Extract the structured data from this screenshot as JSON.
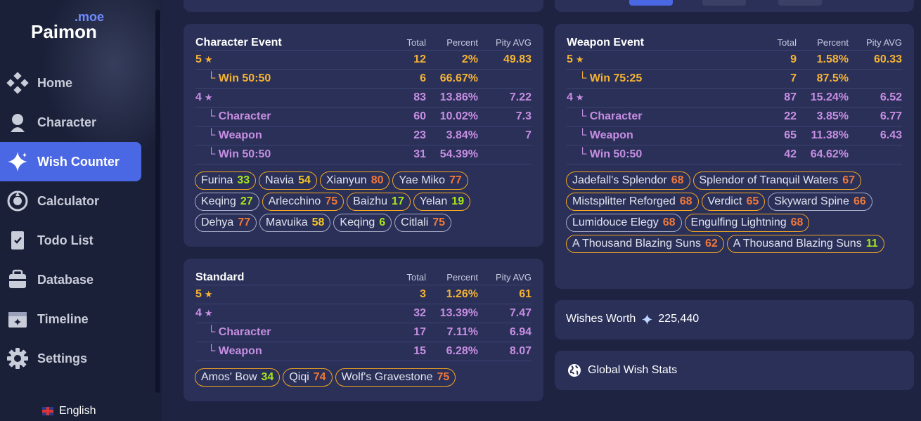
{
  "brand": {
    "moe": ".moe",
    "name": "Paimon"
  },
  "nav": [
    {
      "label": "Home",
      "icon": "home-icon",
      "active": false
    },
    {
      "label": "Character",
      "icon": "character-icon",
      "active": false
    },
    {
      "label": "Wish Counter",
      "icon": "sparkle-icon",
      "active": true
    },
    {
      "label": "Calculator",
      "icon": "calculator-icon",
      "active": false
    },
    {
      "label": "Todo List",
      "icon": "todo-icon",
      "active": false
    },
    {
      "label": "Database",
      "icon": "database-icon",
      "active": false
    },
    {
      "label": "Timeline",
      "icon": "timeline-icon",
      "active": false
    },
    {
      "label": "Settings",
      "icon": "gear-icon",
      "active": false
    }
  ],
  "language": "English",
  "headers": {
    "total": "Total",
    "percent": "Percent",
    "pity": "Pity AVG"
  },
  "character_event": {
    "title": "Character Event",
    "rows": [
      {
        "label": "5",
        "star": true,
        "color": "gold",
        "total": "12",
        "percent": "2%",
        "pity": "49.83"
      },
      {
        "label": "└ Win 50:50",
        "color": "gold",
        "total": "6",
        "percent": "66.67%",
        "pity": ""
      },
      {
        "label": "4",
        "star": true,
        "color": "purple",
        "total": "83",
        "percent": "13.86%",
        "pity": "7.22"
      },
      {
        "label": "└ Character",
        "color": "purple",
        "total": "60",
        "percent": "10.02%",
        "pity": "7.3"
      },
      {
        "label": "└ Weapon",
        "color": "purple",
        "total": "23",
        "percent": "3.84%",
        "pity": "7"
      },
      {
        "label": "└ Win 50:50",
        "color": "purple",
        "total": "31",
        "percent": "54.39%",
        "pity": ""
      }
    ],
    "chips": [
      {
        "name": "Furina",
        "pity": "33",
        "tone": "pg"
      },
      {
        "name": "Navia",
        "pity": "54",
        "tone": "py"
      },
      {
        "name": "Xianyun",
        "pity": "80",
        "tone": "po"
      },
      {
        "name": "Yae Miko",
        "pity": "77",
        "tone": "po"
      },
      {
        "name": "Keqing",
        "pity": "27",
        "tone": "pg",
        "plain": true
      },
      {
        "name": "Arlecchino",
        "pity": "75",
        "tone": "po"
      },
      {
        "name": "Baizhu",
        "pity": "17",
        "tone": "pg"
      },
      {
        "name": "Yelan",
        "pity": "19",
        "tone": "pg"
      },
      {
        "name": "Dehya",
        "pity": "77",
        "tone": "po",
        "plain": true
      },
      {
        "name": "Mavuika",
        "pity": "58",
        "tone": "py",
        "plain": true
      },
      {
        "name": "Keqing",
        "pity": "6",
        "tone": "pg",
        "plain": true
      },
      {
        "name": "Citlali",
        "pity": "75",
        "tone": "po",
        "plain": true
      }
    ]
  },
  "standard": {
    "title": "Standard",
    "rows": [
      {
        "label": "5",
        "star": true,
        "color": "gold",
        "total": "3",
        "percent": "1.26%",
        "pity": "61"
      },
      {
        "label": "4",
        "star": true,
        "color": "purple",
        "total": "32",
        "percent": "13.39%",
        "pity": "7.47"
      },
      {
        "label": "└ Character",
        "color": "purple",
        "total": "17",
        "percent": "7.11%",
        "pity": "6.94"
      },
      {
        "label": "└ Weapon",
        "color": "purple",
        "total": "15",
        "percent": "6.28%",
        "pity": "8.07"
      }
    ],
    "chips": [
      {
        "name": "Amos' Bow",
        "pity": "34",
        "tone": "pg"
      },
      {
        "name": "Qiqi",
        "pity": "74",
        "tone": "po"
      },
      {
        "name": "Wolf's Gravestone",
        "pity": "75",
        "tone": "po"
      }
    ]
  },
  "weapon_event": {
    "title": "Weapon Event",
    "rows": [
      {
        "label": "5",
        "star": true,
        "color": "gold",
        "total": "9",
        "percent": "1.58%",
        "pity": "60.33"
      },
      {
        "label": "└ Win 75:25",
        "color": "gold",
        "total": "7",
        "percent": "87.5%",
        "pity": ""
      },
      {
        "label": "4",
        "star": true,
        "color": "purple",
        "total": "87",
        "percent": "15.24%",
        "pity": "6.52"
      },
      {
        "label": "└ Character",
        "color": "purple",
        "total": "22",
        "percent": "3.85%",
        "pity": "6.77"
      },
      {
        "label": "└ Weapon",
        "color": "purple",
        "total": "65",
        "percent": "11.38%",
        "pity": "6.43"
      },
      {
        "label": "└ Win 50:50",
        "color": "purple",
        "total": "42",
        "percent": "64.62%",
        "pity": ""
      }
    ],
    "chips": [
      {
        "name": "Jadefall's Splendor",
        "pity": "68",
        "tone": "po"
      },
      {
        "name": "Splendor of Tranquil Waters",
        "pity": "67",
        "tone": "po"
      },
      {
        "name": "Mistsplitter Reforged",
        "pity": "68",
        "tone": "po"
      },
      {
        "name": "Verdict",
        "pity": "65",
        "tone": "po"
      },
      {
        "name": "Skyward Spine",
        "pity": "66",
        "tone": "po",
        "plain": true
      },
      {
        "name": "Lumidouce Elegy",
        "pity": "68",
        "tone": "po",
        "plain": true
      },
      {
        "name": "Engulfing Lightning",
        "pity": "68",
        "tone": "po"
      },
      {
        "name": "A Thousand Blazing Suns",
        "pity": "62",
        "tone": "po"
      },
      {
        "name": "A Thousand Blazing Suns",
        "pity": "11",
        "tone": "pg"
      }
    ]
  },
  "wishes_worth": {
    "label": "Wishes Worth",
    "value": "225,440"
  },
  "global_stats": {
    "label": "Global Wish Stats"
  },
  "colors": {
    "accent": "#4a67e4",
    "gold": "#f5b334",
    "purple": "#c78ee2",
    "card": "#2a3058",
    "bg": "#1d2341"
  }
}
